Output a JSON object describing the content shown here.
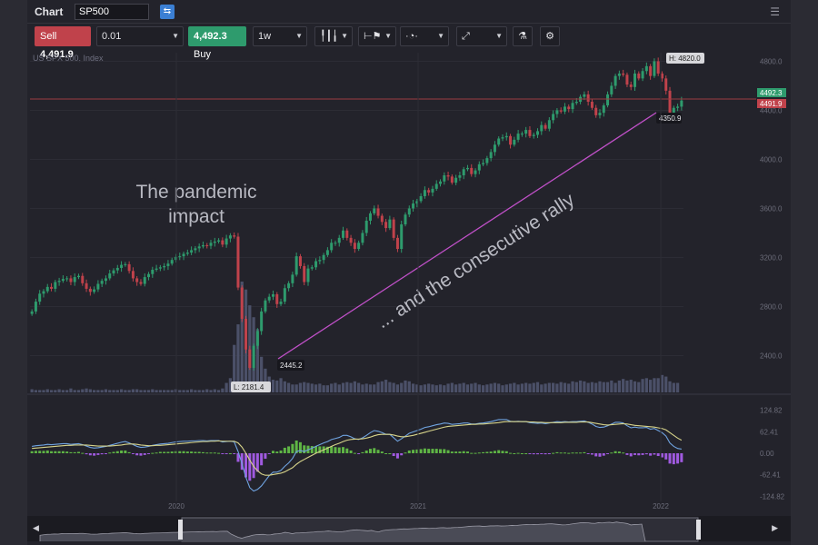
{
  "window": {
    "title": "Chart",
    "symbol": "SP500",
    "link_icon": "link-icon",
    "menu_icon": "hamburger-icon"
  },
  "toolbar": {
    "sell_label": "Sell",
    "sell_price": "4,491.9",
    "quantity": "0.01",
    "buy_price": "4,492.3",
    "buy_label": "Buy",
    "timeframe": "1w",
    "chart_type_icon": "candlestick-icon",
    "indicators_icon": "indicator-flag-icon",
    "timezone_icon": "clock-icon",
    "drawing_icon": "line-tool-icon",
    "studies_icon": "flask-icon",
    "settings_icon": "gear-icon"
  },
  "instrument_label": "US SPX 500, Index",
  "colors": {
    "up": "#2e9b6d",
    "down": "#c0424b",
    "volume": "#4b5068",
    "macd": "#6fa3e0",
    "signal": "#d6d38a",
    "hist_pos": "#5fb545",
    "hist_neg": "#a05ae0",
    "annotation_line": "#c050c8",
    "price_line": "#9b3b40"
  },
  "annotations": {
    "high": "H: 4820.0",
    "low": "L: 2181.4",
    "start": "2445.2",
    "end": "4350.9",
    "text1": "The pandemic impact",
    "text2": "... and the consecutive rally"
  },
  "chart_data": {
    "type": "candlestick",
    "price_axis": {
      "ylim": [
        2100,
        4870
      ],
      "ticks": [
        "4800.0",
        "4400.0",
        "4000.0",
        "3600.0",
        "3200.0",
        "2800.0",
        "2400.0"
      ]
    },
    "price_tags": {
      "buy": "4492.3",
      "sell": "4491.9"
    },
    "x_ticks": [
      "2020",
      "2021",
      "2022"
    ],
    "macd_axis": {
      "ylim": [
        -140,
        140
      ],
      "ticks": [
        "124.82",
        "62.41",
        "0.00",
        "-62.41",
        "-124.82"
      ]
    },
    "closes": [
      2760,
      2840,
      2905,
      2925,
      2960,
      2945,
      3000,
      3010,
      3025,
      3030,
      3000,
      3040,
      3050,
      2990,
      2945,
      2920,
      2940,
      2985,
      3010,
      3030,
      3070,
      3095,
      3115,
      3140,
      3145,
      3090,
      3030,
      3000,
      2985,
      3040,
      3065,
      3100,
      3110,
      3120,
      3130,
      3150,
      3180,
      3205,
      3210,
      3230,
      3240,
      3260,
      3275,
      3290,
      3300,
      3295,
      3320,
      3330,
      3340,
      3305,
      3355,
      3380,
      3370,
      2955,
      2700,
      2450,
      2300,
      2480,
      2600,
      2760,
      2850,
      2880,
      2900,
      2820,
      2840,
      2950,
      2990,
      3060,
      3210,
      3130,
      3000,
      3110,
      3120,
      3170,
      3180,
      3220,
      3260,
      3320,
      3320,
      3360,
      3420,
      3360,
      3320,
      3270,
      3320,
      3400,
      3500,
      3560,
      3600,
      3540,
      3490,
      3440,
      3510,
      3360,
      3270,
      3470,
      3550,
      3600,
      3640,
      3660,
      3700,
      3750,
      3730,
      3760,
      3800,
      3820,
      3870,
      3860,
      3810,
      3850,
      3870,
      3920,
      3930,
      3880,
      3910,
      3960,
      3970,
      4010,
      4060,
      4120,
      4170,
      4180,
      4190,
      4120,
      4160,
      4210,
      4210,
      4240,
      4190,
      4200,
      4230,
      4280,
      4250,
      4320,
      4370,
      4400,
      4390,
      4430,
      4410,
      4460,
      4470,
      4510,
      4530,
      4470,
      4420,
      4360,
      4380,
      4440,
      4530,
      4600,
      4680,
      4700,
      4690,
      4610,
      4590,
      4700,
      4660,
      4720,
      4760,
      4680,
      4800,
      4700,
      4660,
      4560,
      4350,
      4420,
      4430,
      4480
    ],
    "volume": [
      4,
      3,
      3,
      3,
      4,
      3,
      3,
      4,
      3,
      3,
      5,
      3,
      3,
      4,
      5,
      4,
      3,
      3,
      3,
      4,
      3,
      3,
      3,
      4,
      3,
      3,
      4,
      4,
      3,
      3,
      3,
      4,
      3,
      3,
      3,
      3,
      3,
      4,
      3,
      3,
      3,
      4,
      3,
      3,
      3,
      4,
      3,
      4,
      3,
      5,
      12,
      18,
      60,
      86,
      140,
      130,
      110,
      95,
      80,
      45,
      30,
      20,
      16,
      15,
      18,
      14,
      12,
      10,
      10,
      12,
      13,
      12,
      11,
      10,
      11,
      9,
      9,
      11,
      12,
      10,
      12,
      13,
      12,
      14,
      12,
      10,
      11,
      10,
      10,
      13,
      14,
      16,
      13,
      12,
      10,
      12,
      15,
      14,
      11,
      10,
      9,
      10,
      11,
      10,
      9,
      10,
      9,
      11,
      12,
      10,
      11,
      12,
      10,
      11,
      12,
      10,
      9,
      10,
      11,
      12,
      11,
      9,
      10,
      11,
      12,
      10,
      11,
      12,
      11,
      12,
      13,
      10,
      11,
      12,
      12,
      11,
      13,
      12,
      11,
      14,
      13,
      15,
      14,
      12,
      13,
      12,
      14,
      13,
      13,
      15,
      12,
      15,
      17,
      15,
      16,
      14,
      13,
      17,
      18,
      16,
      18,
      18,
      22,
      20,
      14,
      12,
      12
    ],
    "macd": [
      20,
      22,
      23,
      24,
      26,
      25,
      26,
      27,
      28,
      28,
      26,
      27,
      28,
      25,
      21,
      17,
      15,
      16,
      18,
      20,
      23,
      26,
      29,
      32,
      34,
      30,
      25,
      20,
      17,
      18,
      20,
      23,
      25,
      27,
      28,
      29,
      31,
      33,
      34,
      35,
      35,
      36,
      36,
      37,
      37,
      36,
      37,
      37,
      37,
      33,
      34,
      35,
      33,
      5,
      -30,
      -70,
      -100,
      -110,
      -105,
      -95,
      -80,
      -65,
      -55,
      -55,
      -50,
      -38,
      -28,
      -15,
      5,
      8,
      5,
      10,
      15,
      20,
      25,
      30,
      34,
      40,
      43,
      46,
      52,
      52,
      48,
      42,
      40,
      45,
      52,
      60,
      66,
      64,
      60,
      55,
      55,
      45,
      35,
      42,
      50,
      58,
      62,
      66,
      70,
      75,
      77,
      80,
      83,
      85,
      88,
      87,
      84,
      85,
      86,
      88,
      88,
      85,
      85,
      87,
      88,
      90,
      92,
      95,
      98,
      98,
      98,
      93,
      92,
      93,
      92,
      92,
      89,
      88,
      87,
      88,
      86,
      88,
      90,
      92,
      91,
      92,
      91,
      92,
      92,
      93,
      94,
      90,
      85,
      78,
      75,
      76,
      80,
      85,
      90,
      90,
      88,
      80,
      74,
      76,
      74,
      74,
      75,
      70,
      72,
      66,
      60,
      50,
      30,
      20,
      14,
      12
    ],
    "signal": [
      14,
      15,
      16,
      17,
      18,
      19,
      20,
      21,
      22,
      23,
      23,
      24,
      24,
      24,
      24,
      23,
      22,
      21,
      21,
      21,
      21,
      22,
      23,
      24,
      26,
      27,
      27,
      26,
      24,
      23,
      22,
      22,
      23,
      23,
      24,
      25,
      26,
      27,
      28,
      29,
      30,
      31,
      32,
      33,
      34,
      34,
      35,
      35,
      36,
      35,
      35,
      35,
      35,
      30,
      18,
      0,
      -20,
      -38,
      -51,
      -60,
      -64,
      -64,
      -62,
      -60,
      -58,
      -54,
      -48,
      -42,
      -32,
      -24,
      -18,
      -12,
      -6,
      0,
      5,
      10,
      15,
      20,
      25,
      29,
      34,
      38,
      40,
      41,
      41,
      42,
      44,
      47,
      51,
      54,
      55,
      55,
      55,
      53,
      50,
      48,
      48,
      50,
      52,
      55,
      58,
      61,
      64,
      67,
      70,
      73,
      76,
      78,
      79,
      80,
      81,
      82,
      83,
      84,
      84,
      85,
      85,
      86,
      87,
      88,
      89,
      91,
      92,
      92,
      92,
      92,
      92,
      92,
      91,
      91,
      90,
      90,
      89,
      89,
      89,
      89,
      89,
      90,
      90,
      90,
      90,
      91,
      91,
      91,
      89,
      87,
      85,
      83,
      82,
      83,
      84,
      85,
      86,
      85,
      83,
      81,
      80,
      79,
      78,
      77,
      76,
      74,
      72,
      68,
      60,
      52,
      44,
      38
    ]
  }
}
